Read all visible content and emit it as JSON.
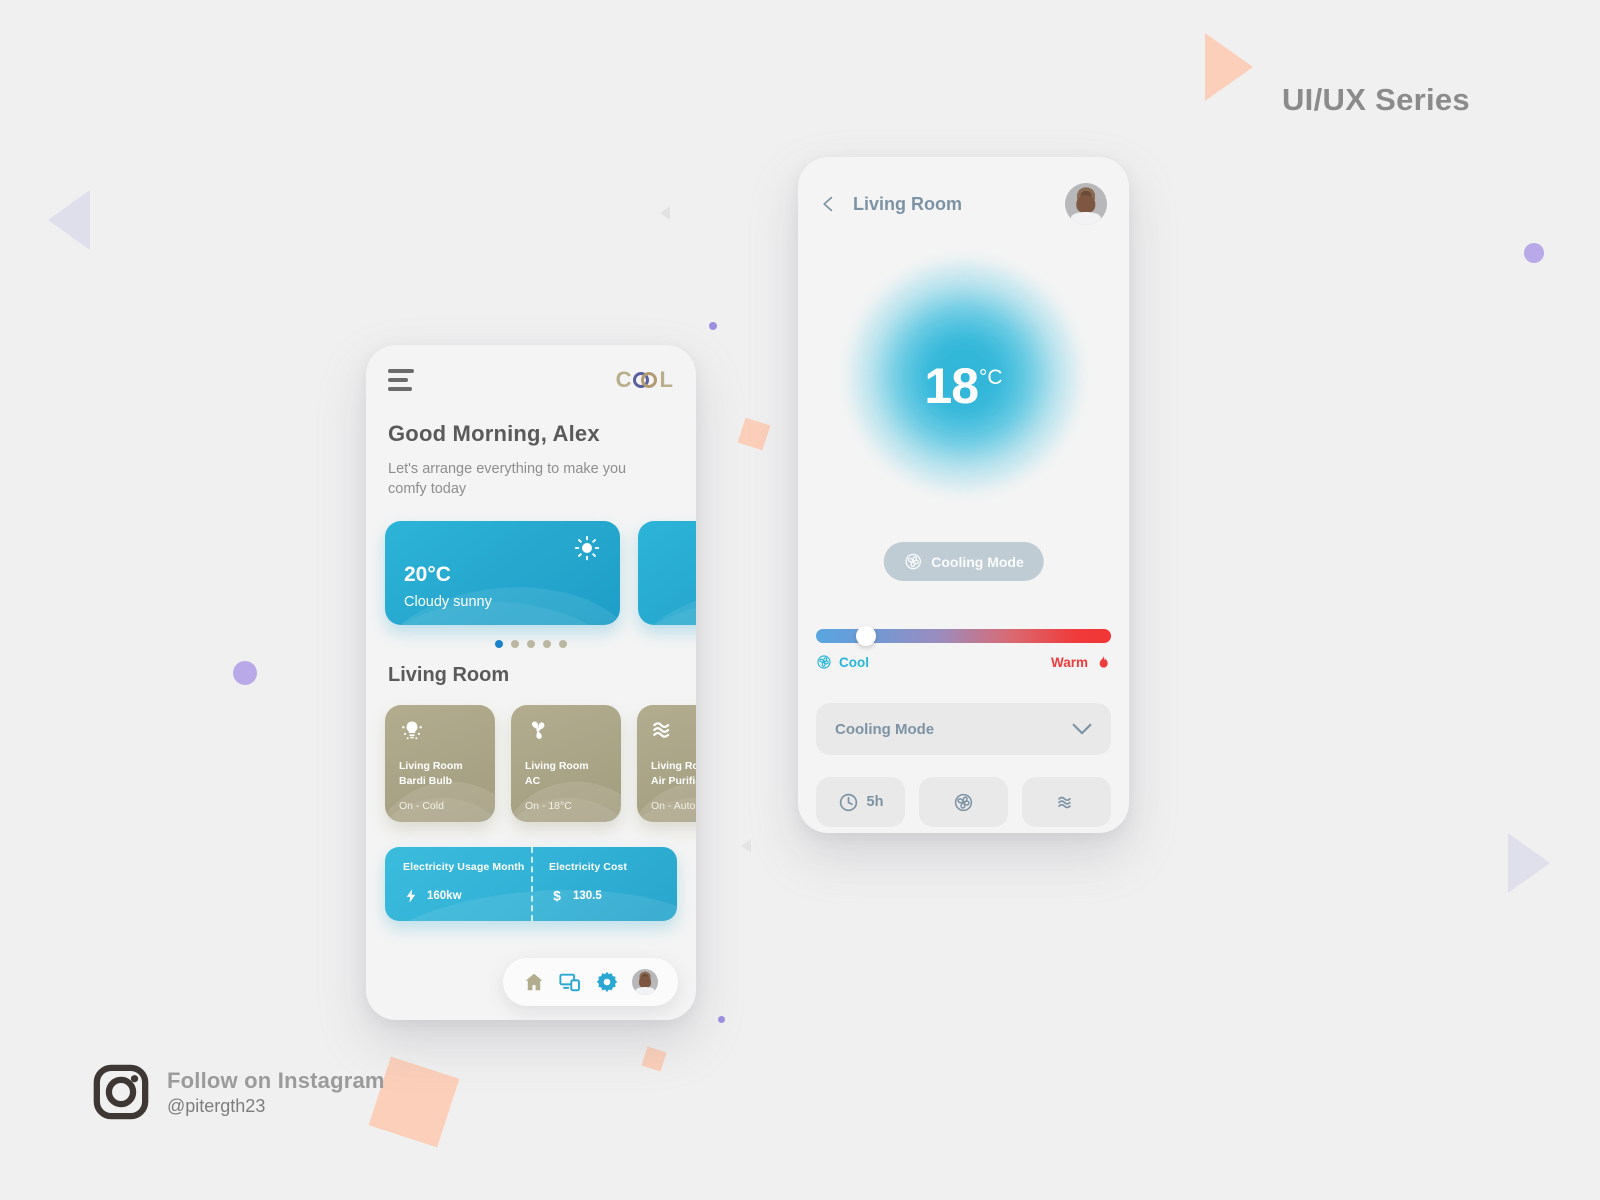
{
  "page": {
    "series_title": "UI/UX Series",
    "background_color": "#f0f0f0"
  },
  "instagram": {
    "icon": "instagram-icon",
    "line1": "Follow on Instagram",
    "handle": "@pitergth23"
  },
  "phone_home": {
    "menu_icon": "hamburger-menu-icon",
    "logo": {
      "prefix": "C",
      "suffix": "L",
      "full": "COOL"
    },
    "greeting": {
      "title": "Good Morning, Alex",
      "subtitle": "Let's arrange everything to make you comfy today"
    },
    "weather_cards": [
      {
        "temp": "20°C",
        "condition": "Cloudy sunny",
        "icon": "sun-icon"
      },
      {
        "temp": "",
        "condition": "",
        "icon": "sun-icon"
      }
    ],
    "carousel": {
      "total_dots": 5,
      "active_index": 0,
      "active_color": "#1a82c9",
      "inactive_color": "#bfb89f"
    },
    "section_title": "Living Room",
    "devices": [
      {
        "icon": "light-bulb-icon",
        "name_line1": "Living Room",
        "name_line2": "Bardi Bulb",
        "state": "On - Cold"
      },
      {
        "icon": "fan-icon",
        "name_line1": "Living Room",
        "name_line2": "AC",
        "state": "On - 18°C"
      },
      {
        "icon": "air-wave-icon",
        "name_line1": "Living Room",
        "name_line2": "Air Purifier",
        "state": "On - Auto"
      }
    ],
    "stats": [
      {
        "label": "Electricity Usage Month",
        "icon": "lightning-bolt-icon",
        "value": "160kw"
      },
      {
        "label": "Electricity Cost",
        "icon": "dollar-icon",
        "value": "130.5"
      }
    ],
    "bottom_nav": [
      {
        "icon": "home-icon",
        "active": true,
        "color": "#b3ad90"
      },
      {
        "icon": "devices-icon",
        "active": false,
        "color": "#29a8d4"
      },
      {
        "icon": "gear-icon",
        "active": false,
        "color": "#29a8d4"
      },
      {
        "icon": "avatar",
        "active": false,
        "color": ""
      }
    ]
  },
  "phone_detail": {
    "back_icon": "chevron-left-icon",
    "title": "Living Room",
    "avatar": "user-avatar",
    "temperature": {
      "value": "18",
      "unit": "°C"
    },
    "mode_pill": {
      "icon": "fan-icon",
      "label": "Cooling Mode",
      "background": "#c0ccd4"
    },
    "slider": {
      "position_percent": 17,
      "left_label": "Cool",
      "left_icon": "fan-icon",
      "left_color": "#26b6d8",
      "right_label": "Warm",
      "right_icon": "flame-icon",
      "right_color": "#ee3c3c"
    },
    "dropdown": {
      "label": "Cooling Mode",
      "icon": "chevron-down-icon"
    },
    "actions": [
      {
        "icon": "clock-icon",
        "label": "5h"
      },
      {
        "icon": "fan-icon",
        "label": ""
      },
      {
        "icon": "air-wave-icon",
        "label": ""
      }
    ]
  }
}
